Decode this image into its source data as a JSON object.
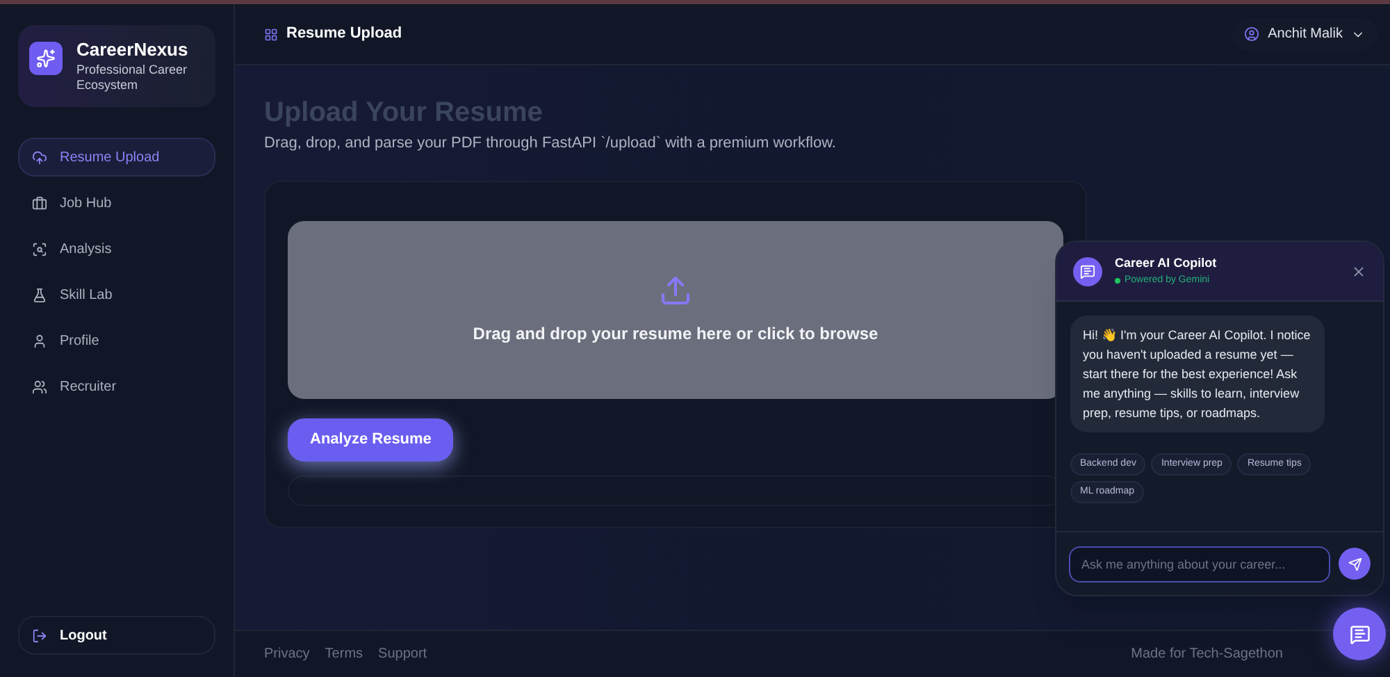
{
  "brand": {
    "name": "CareerNexus",
    "tagline": "Professional Career Ecosystem"
  },
  "sidebar": {
    "items": [
      {
        "label": "Resume Upload",
        "selected": true
      },
      {
        "label": "Job Hub",
        "selected": false
      },
      {
        "label": "Analysis",
        "selected": false
      },
      {
        "label": "Skill Lab",
        "selected": false
      },
      {
        "label": "Profile",
        "selected": false
      },
      {
        "label": "Recruiter",
        "selected": false
      }
    ],
    "logout": "Logout"
  },
  "header": {
    "title": "Resume Upload",
    "user": "Anchit Malik"
  },
  "page": {
    "title": "Upload Your Resume",
    "subtitle": "Drag, drop, and parse your PDF through FastAPI `/upload` with a premium workflow.",
    "dropzone": "Drag and drop your resume here or click to browse",
    "button": "Analyze Resume"
  },
  "footer": {
    "links": [
      "Privacy",
      "Terms",
      "Support"
    ],
    "credit": "Made for Tech-Sagethon"
  },
  "chat": {
    "title": "Career AI Copilot",
    "status": "Powered by Gemini",
    "online": true,
    "message": "Hi! 👋 I'm your Career AI Copilot. I notice you haven't uploaded a resume yet — start there for the best experience! Ask me anything — skills to learn, interview prep, resume tips, or roadmaps.",
    "suggestions": [
      "Backend dev",
      "Interview prep",
      "Resume tips",
      "ML roadmap"
    ],
    "placeholder": "Ask me anything about your career..."
  }
}
